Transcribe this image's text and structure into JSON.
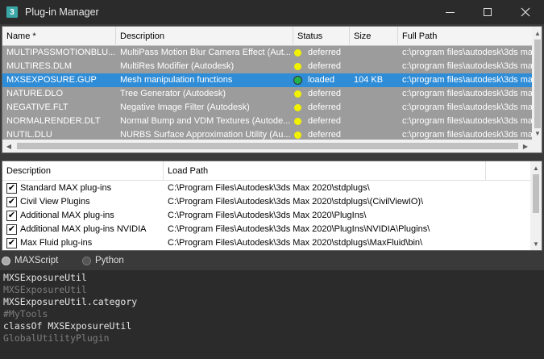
{
  "window": {
    "title": "Plug-in Manager",
    "icon_letter": "3"
  },
  "plugins": {
    "columns": [
      "Name *",
      "Description",
      "Status",
      "Size",
      "Full Path"
    ],
    "rows": [
      {
        "name": "MULTIPASSMOTIONBLU...",
        "description": "MultiPass Motion Blur Camera Effect (Aut...",
        "status": "deferred",
        "size": "",
        "path": "c:\\program files\\autodesk\\3ds ma",
        "status_color": "#f2f200",
        "selected": false
      },
      {
        "name": "MULTIRES.DLM",
        "description": "MultiRes Modifier (Autodesk)",
        "status": "deferred",
        "size": "",
        "path": "c:\\program files\\autodesk\\3ds ma",
        "status_color": "#f2f200",
        "selected": false
      },
      {
        "name": "MXSEXPOSURE.GUP",
        "description": "Mesh manipulation functions",
        "status": "loaded",
        "size": "104 KB",
        "path": "c:\\program files\\autodesk\\3ds ma",
        "status_color": "#22b14c",
        "selected": true
      },
      {
        "name": "NATURE.DLO",
        "description": "Tree Generator (Autodesk)",
        "status": "deferred",
        "size": "",
        "path": "c:\\program files\\autodesk\\3ds ma",
        "status_color": "#f2f200",
        "selected": false
      },
      {
        "name": "NEGATIVE.FLT",
        "description": "Negative Image Filter (Autodesk)",
        "status": "deferred",
        "size": "",
        "path": "c:\\program files\\autodesk\\3ds ma",
        "status_color": "#f2f200",
        "selected": false
      },
      {
        "name": "NORMALRENDER.DLT",
        "description": "Normal Bump and VDM Textures (Autode...",
        "status": "deferred",
        "size": "",
        "path": "c:\\program files\\autodesk\\3ds ma",
        "status_color": "#f2f200",
        "selected": false
      },
      {
        "name": "NUTIL.DLU",
        "description": "NURBS Surface Approximation Utility (Au...",
        "status": "deferred",
        "size": "",
        "path": "c:\\program files\\autodesk\\3ds ma",
        "status_color": "#f2f200",
        "selected": false
      }
    ]
  },
  "load_paths": {
    "columns": [
      "Description",
      "Load Path"
    ],
    "rows": [
      {
        "description": "Standard MAX plug-ins",
        "path": "C:\\Program Files\\Autodesk\\3ds Max 2020\\stdplugs\\",
        "checked": true
      },
      {
        "description": "Civil View Plugins",
        "path": "C:\\Program Files\\Autodesk\\3ds Max 2020\\stdplugs\\(CivilViewIO)\\",
        "checked": true
      },
      {
        "description": "Additional MAX plug-ins",
        "path": "C:\\Program Files\\Autodesk\\3ds Max 2020\\PlugIns\\",
        "checked": true
      },
      {
        "description": "Additional MAX plug-ins NVIDIA",
        "path": "C:\\Program Files\\Autodesk\\3ds Max 2020\\PlugIns\\NVIDIA\\Plugins\\",
        "checked": true
      },
      {
        "description": "Max Fluid plug-ins",
        "path": "C:\\Program Files\\Autodesk\\3ds Max 2020\\stdplugs\\MaxFluid\\bin\\",
        "checked": true
      }
    ]
  },
  "tabs": [
    {
      "label": "MAXScript",
      "selected": true
    },
    {
      "label": "Python",
      "selected": false
    }
  ],
  "listener": {
    "lines": [
      {
        "text": "MXSExposureUtil",
        "kind": "input"
      },
      {
        "text": "MXSExposureUtil",
        "kind": "output"
      },
      {
        "text": "MXSExposureUtil.category",
        "kind": "input"
      },
      {
        "text": "#MyTools",
        "kind": "output"
      },
      {
        "text": "classOf MXSExposureUtil",
        "kind": "input"
      },
      {
        "text": "GlobalUtilityPlugin",
        "kind": "output"
      }
    ]
  },
  "colors": {
    "selected_row": "#2f8dd8",
    "row_bg": "#9c9c9c",
    "deferred_dot": "#f2f200",
    "loaded_dot": "#22b14c"
  },
  "icons": [
    "3ds-max-app-icon",
    "minimize-icon",
    "maximize-icon",
    "close-icon",
    "scroll-up-arrow-icon",
    "scroll-down-arrow-icon",
    "scroll-left-arrow-icon",
    "scroll-right-arrow-icon",
    "checkbox-checked-icon",
    "radio-icon"
  ]
}
